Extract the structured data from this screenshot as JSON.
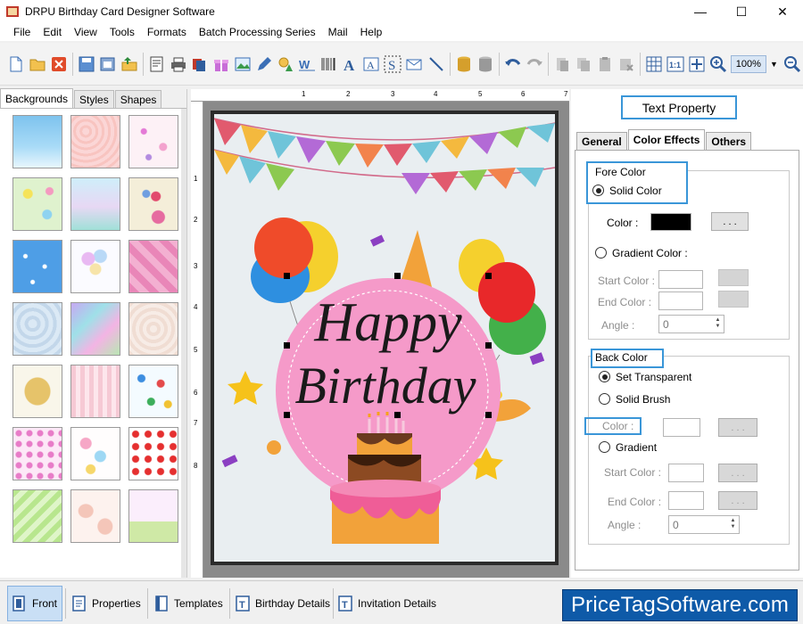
{
  "window": {
    "title": "DRPU Birthday Card Designer Software",
    "buttons": {
      "minimize": "—",
      "maximize": "☐",
      "close": "✕"
    }
  },
  "menu": [
    "File",
    "Edit",
    "View",
    "Tools",
    "Formats",
    "Batch Processing Series",
    "Mail",
    "Help"
  ],
  "toolbar": {
    "zoom": "100%"
  },
  "left_panel": {
    "tabs": [
      "Backgrounds",
      "Styles",
      "Shapes"
    ],
    "active_tab": "Backgrounds"
  },
  "ruler": {
    "top": [
      "1",
      "2",
      "3",
      "4",
      "5",
      "6",
      "7"
    ],
    "left": [
      "1",
      "2",
      "3",
      "4",
      "5",
      "6",
      "7",
      "8"
    ]
  },
  "card": {
    "line1": "Happy",
    "line2": "Birthday"
  },
  "right_panel": {
    "header": "Text Property",
    "tabs": [
      "General",
      "Color Effects",
      "Others"
    ],
    "active_tab": "Color Effects",
    "fore": {
      "title": "Fore Color",
      "solid": "Solid Color",
      "color_label": "Color :",
      "color_value": "#000000",
      "browse": ". . .",
      "gradient": "Gradient Color :",
      "start": "Start Color :",
      "end": "End Color :",
      "angle": "Angle :",
      "angle_value": "0"
    },
    "back": {
      "title": "Back Color",
      "transparent": "Set Transparent",
      "solid_brush": "Solid Brush",
      "color_label": "Color :",
      "browse": ". . .",
      "gradient": "Gradient",
      "start": "Start Color :",
      "end": "End Color :",
      "angle": "Angle :",
      "angle_value": "0"
    }
  },
  "bottom_tabs": [
    "Front",
    "Properties",
    "Templates",
    "Birthday Details",
    "Invitation Details"
  ],
  "brand": "PriceTagSoftware.com",
  "colors": {
    "accent": "#3a96d8",
    "brand_bg": "#0e5aa8",
    "card_circle": "#f59ac9"
  }
}
